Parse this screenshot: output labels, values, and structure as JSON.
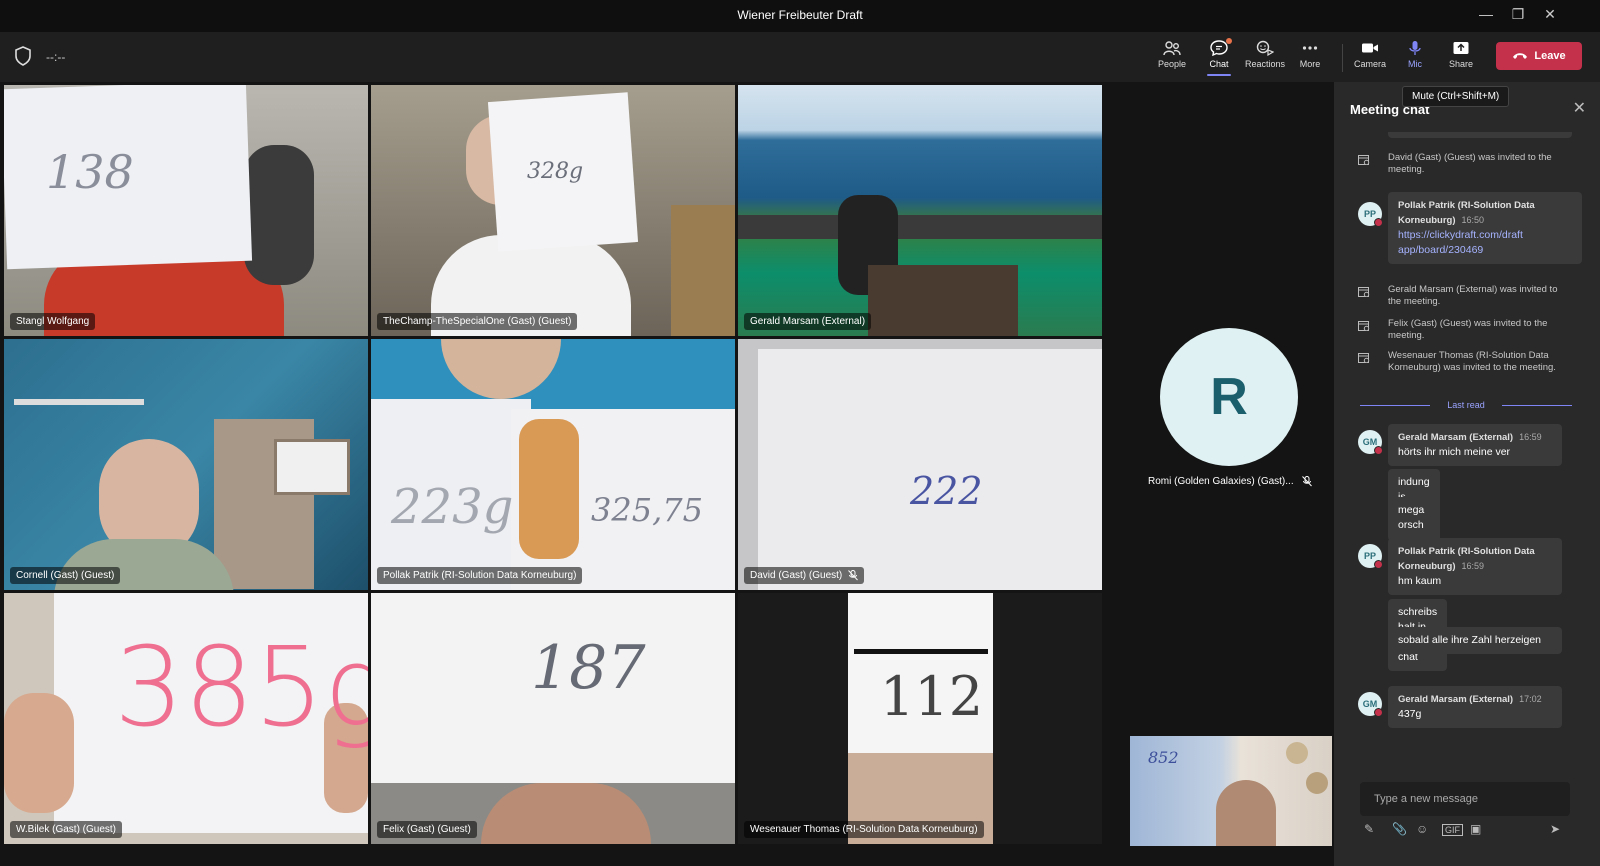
{
  "window": {
    "title": "Wiener Freibeuter Draft"
  },
  "toolbar": {
    "timer": "--:--",
    "people": "People",
    "chat": "Chat",
    "reactions": "Reactions",
    "more": "More",
    "camera": "Camera",
    "mic": "Mic",
    "share": "Share",
    "leave": "Leave",
    "mic_tooltip": "Mute (Ctrl+Shift+M)"
  },
  "participants": [
    {
      "name": "Stangl Wolfgang",
      "sign": "138"
    },
    {
      "name": "TheChamp-TheSpecialOne (Gast) (Guest)",
      "sign": "328g"
    },
    {
      "name": "Gerald Marsam (External)"
    },
    {
      "name": "Cornell (Gast) (Guest)"
    },
    {
      "name": "Pollak Patrik (RI-Solution Data Korneuburg)",
      "sign": "223g",
      "sign2": "325,75"
    },
    {
      "name": "David (Gast) (Guest)",
      "sign": "222"
    },
    {
      "name": "W.Bilek (Gast) (Guest)",
      "sign": "385g"
    },
    {
      "name": "Felix (Gast) (Guest)",
      "sign": "187"
    },
    {
      "name": "Wesenauer Thomas (RI-Solution Data Korneuburg)",
      "sign": "112"
    },
    {
      "name": "Romi (Golden Galaxies) (Gast)...",
      "initial": "R"
    }
  ],
  "self_view": {
    "sign": "852"
  },
  "chat": {
    "title": "Meeting chat",
    "events": [
      "David (Gast) (Guest) was invited to the meeting.",
      "Gerald Marsam (External) was invited to the meeting.",
      "Felix (Gast) (Guest) was invited to the meeting.",
      "Wesenauer Thomas (RI-Solution Data Korneuburg) was invited to the meeting."
    ],
    "messages": [
      {
        "initials": "PP",
        "author": "Pollak Patrik (RI-Solution Data Korneuburg)",
        "time": "16:50",
        "lines": [
          "https://clickydraft.com/draft",
          "app/board/230469"
        ]
      },
      {
        "initials": "GM",
        "author": "Gerald Marsam (External)",
        "time": "16:59",
        "lines": [
          "hörts ihr mich meine ver",
          "indung is grade meg",
          "mega orsch"
        ]
      },
      {
        "initials": "PP",
        "author": "Pollak Patrik (RI-Solution Data Korneuburg)",
        "time": "16:59",
        "lines": [
          "hm kaum",
          "schreibs halt in den chat",
          "sobald alle ihre Zahl herzeigen"
        ]
      },
      {
        "initials": "GM",
        "author": "Gerald Marsam (External)",
        "time": "17:02",
        "lines": [
          "437g"
        ]
      }
    ],
    "last_read": "Last read",
    "input_placeholder": "Type a new message"
  }
}
